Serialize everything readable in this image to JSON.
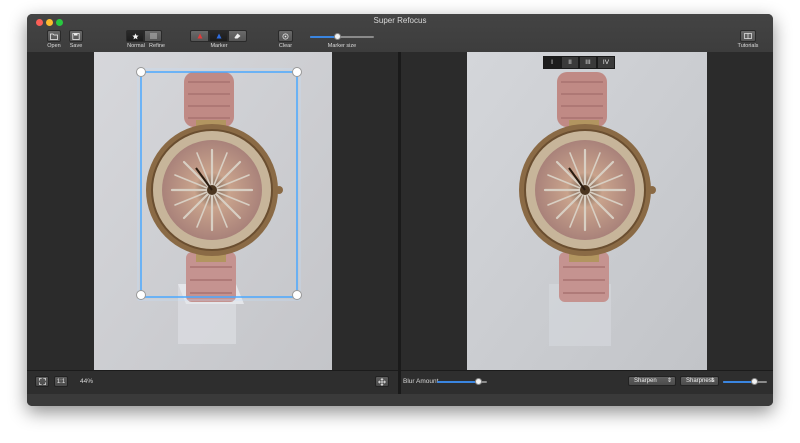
{
  "window": {
    "title": "Super Refocus"
  },
  "toolbar": {
    "open_label": "Open",
    "save_label": "Save",
    "normal_label": "Normal",
    "refine_label": "Refine",
    "marker_label": "Marker",
    "clear_label": "Clear",
    "marker_size_label": "Marker size",
    "marker_size_value": 0.42,
    "tutorials_label": "Tutorials",
    "mode_selected": "Normal"
  },
  "left_status": {
    "one_to_one_label": "1:1",
    "zoom_text": "44%"
  },
  "right_status": {
    "blur_amount_label": "Blur Amount",
    "blur_amount_value": 0.82,
    "sharpen_popup": "Sharpen",
    "sharpness_popup": "Sharpness",
    "sharpness_value": 0.7
  },
  "preview_tabs": [
    "I",
    "II",
    "III",
    "IV"
  ],
  "preview_tab_selected": 0,
  "colors": {
    "accent": "#3a85e0",
    "selection": "#4aa8ff",
    "marker_red": "#e23b3b",
    "marker_blue": "#2f6de0"
  }
}
